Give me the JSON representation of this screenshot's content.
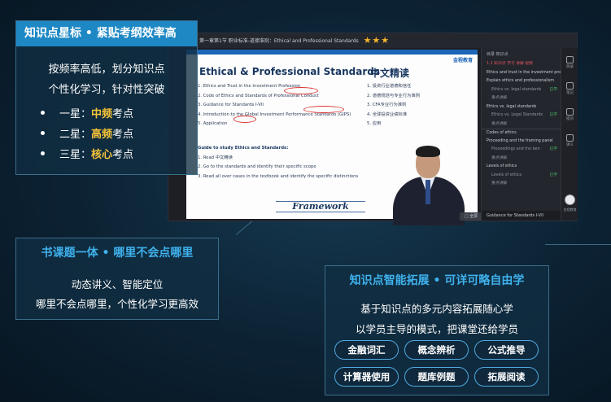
{
  "window": {
    "title": "第一章第1节 职业标准-道德准则：Ethical and Professional Standards",
    "stars": "★★★",
    "slide": {
      "logo": "金程教育",
      "title": "Ethical & Professional Standards",
      "cn_title": "中文精读",
      "items": [
        "1.  Ethics and Trust in the Investment Profession",
        "2.  Code of Ethics and Standards of Professional Conduct",
        "3.  Guidance for Standards I-VII",
        "4.  Introduction to the Global Investment Performance Standards (GIPS)",
        "5.  Application"
      ],
      "cn_items": [
        "1. 投资行业道德和信任",
        "2. 道德规范与专业行为准则",
        "3. CFA专业行为准则",
        "4. 全球投资业绩标准",
        "5. 应用"
      ],
      "guide_title": "Guide to study Ethics and Standards:",
      "guide": [
        "1.  Read 中文精读",
        "2.  Go to the standards and identify their specific scope",
        "3.  Read all over cases in the textbook and identify the specific distinctions"
      ],
      "framework": "Framework"
    },
    "button": "□ 全屏",
    "sidebar": {
      "header": "目录  知识点",
      "rows": [
        {
          "text": "1.1 知识点 学习 讲解 视频",
          "style": "hl",
          "tag": ""
        },
        {
          "text": "Ethics and trust in the investment pro",
          "style": "",
          "tag": ""
        },
        {
          "text": "Explain ethics and professionalism",
          "style": "",
          "tag": ""
        },
        {
          "text": "Ethics vs. legal standards",
          "style": "sub",
          "tag": "已学"
        },
        {
          "text": "重点讲解",
          "style": "sub",
          "tag": ""
        },
        {
          "text": "Ethics vs. legal standards",
          "style": "",
          "tag": ""
        },
        {
          "text": "Ethics vs. Legal Standards",
          "style": "sub",
          "tag": "已学"
        },
        {
          "text": "重点讲解",
          "style": "sub",
          "tag": ""
        },
        {
          "text": "Codes of ethics",
          "style": "sect",
          "tag": ""
        },
        {
          "text": "Proceeding and the framing panel",
          "style": "",
          "tag": ""
        },
        {
          "text": "Proceedings and the ben",
          "style": "sub",
          "tag": "已学"
        },
        {
          "text": "重点讲解",
          "style": "sub",
          "tag": ""
        },
        {
          "text": "Levels of ethics",
          "style": "",
          "tag": ""
        },
        {
          "text": "Levels of ethics",
          "style": "sub",
          "tag": "已学"
        },
        {
          "text": "重点讲解",
          "style": "sub",
          "tag": ""
        }
      ],
      "footer": "Guidance for Standards I-VII"
    },
    "rail": [
      "目录",
      "笔记",
      "提问",
      "讲义"
    ],
    "avatar_label": "金程教育"
  },
  "panel1": {
    "title": "知识点星标 • 紧贴考纲效率高",
    "line1": "按频率高低，划分知识点",
    "line2": "个性化学习，针对性突破",
    "stars": [
      {
        "prefix": "一星：",
        "highlight": "中频",
        "suffix": "考点"
      },
      {
        "prefix": "二星：",
        "highlight": "高频",
        "suffix": "考点"
      },
      {
        "prefix": "三星：",
        "highlight": "核心",
        "suffix": "考点"
      }
    ]
  },
  "panel2": {
    "title": "书课题一体 • 哪里不会点哪里",
    "line1": "动态讲义、智能定位",
    "line2": "哪里不会点哪里，个性化学习更高效"
  },
  "panel3": {
    "title": "知识点智能拓展 • 可详可略自由学",
    "line1": "基于知识点的多元内容拓展随心学",
    "line2": "以学员主导的模式，把课堂还给学员",
    "chips": [
      "金融词汇",
      "概念辨析",
      "公式推导",
      "计算器使用",
      "题库例题",
      "拓展阅读"
    ]
  },
  "colors": {
    "accent": "#1e88c5",
    "highlight": "#f6c43a",
    "star": "#f3b52c"
  }
}
